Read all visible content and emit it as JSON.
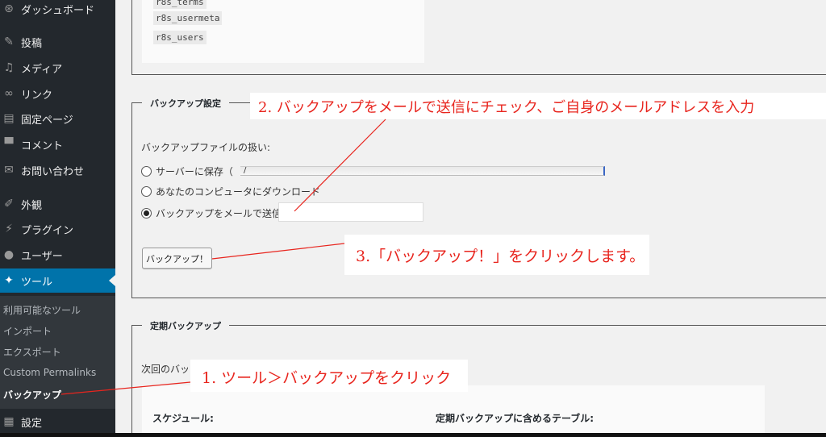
{
  "sidebar": {
    "items": [
      {
        "label": "ダッシュボード",
        "icon": "dashboard-icon",
        "glyph": "⊛"
      },
      {
        "label": "投稿",
        "icon": "pin-icon",
        "glyph": "✎"
      },
      {
        "label": "メディア",
        "icon": "media-icon",
        "glyph": "♫"
      },
      {
        "label": "リンク",
        "icon": "link-icon",
        "glyph": "∞"
      },
      {
        "label": "固定ページ",
        "icon": "page-icon",
        "glyph": "▤"
      },
      {
        "label": "コメント",
        "icon": "comment-icon",
        "glyph": "▀"
      },
      {
        "label": "お問い合わせ",
        "icon": "mail-icon",
        "glyph": "✉"
      },
      {
        "label": "外観",
        "icon": "appearance-icon",
        "glyph": "✐"
      },
      {
        "label": "プラグイン",
        "icon": "plugin-icon",
        "glyph": "⚡"
      },
      {
        "label": "ユーザー",
        "icon": "user-icon",
        "glyph": "●"
      },
      {
        "label": "ツール",
        "icon": "wrench-icon",
        "glyph": "✦"
      },
      {
        "label": "設定",
        "icon": "settings-icon",
        "glyph": "▦"
      }
    ],
    "submenu": [
      "利用可能なツール",
      "インポート",
      "エクスポート",
      "Custom Permalinks",
      "バックアップ"
    ]
  },
  "tables": [
    "r8s_terms",
    "r8s_usermeta",
    "r8s_users"
  ],
  "backup_settings": {
    "legend": "バックアップ設定",
    "handling_label": "バックアップファイルの扱い:",
    "options": [
      "サーバーに保存（",
      "あなたのコンピュータにダウンロード",
      "バックアップをメールで送信:"
    ],
    "path_value": "/",
    "email_value": "",
    "button_label": "バックアップ！"
  },
  "scheduled": {
    "legend": "定期バックアップ",
    "next_label": "次回のバッ",
    "schedule_label": "スケジュール:",
    "tables_label": "定期バックアップに含めるテーブル:"
  },
  "callouts": {
    "step1": "1. ツール＞バックアップをクリック",
    "step2": "2. バックアップをメールで送信にチェック、ご自身のメールアドレスを入力",
    "step3": "3.「バックアップ！」をクリックします。"
  },
  "colors": {
    "sidebar": "#23282d",
    "active": "#0073aa",
    "callout": "#e8251e"
  }
}
